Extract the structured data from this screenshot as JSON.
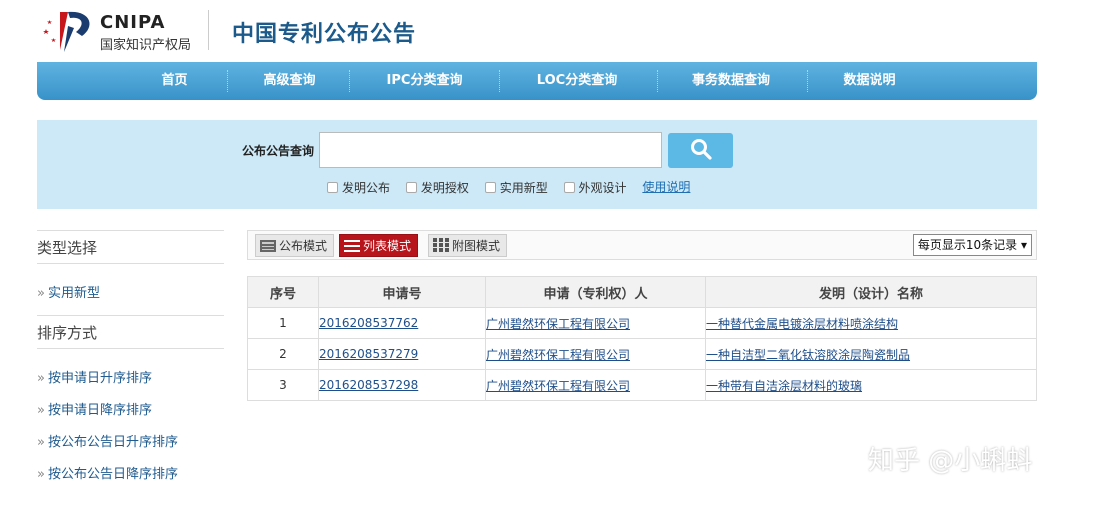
{
  "header": {
    "logo_en": "CNIPA",
    "logo_cn": "国家知识产权局",
    "site_title": "中国专利公布公告"
  },
  "nav": {
    "items": [
      "首页",
      "高级查询",
      "IPC分类查询",
      "LOC分类查询",
      "事务数据查询",
      "数据说明"
    ]
  },
  "search": {
    "label": "公布公告查询",
    "value": "",
    "placeholder": "",
    "options": [
      "发明公布",
      "发明授权",
      "实用新型",
      "外观设计"
    ],
    "help": "使用说明",
    "icon": "search-icon"
  },
  "sidebar": {
    "type_title": "类型选择",
    "type_items": [
      "实用新型"
    ],
    "sort_title": "排序方式",
    "sort_items": [
      "按申请日升序排序",
      "按申请日降序排序",
      "按公布公告日升序排序",
      "按公布公告日降序排序"
    ]
  },
  "toolbar": {
    "modes": [
      "公布模式",
      "列表模式",
      "附图模式"
    ],
    "active_mode": "列表模式",
    "per_page": "每页显示10条记录 ▾"
  },
  "table": {
    "headers": [
      "序号",
      "申请号",
      "申请（专利权）人",
      "发明（设计）名称"
    ],
    "rows": [
      [
        "1",
        "2016208537762",
        "广州碧然环保工程有限公司",
        "一种替代金属电镀涂层材料喷涂结构"
      ],
      [
        "2",
        "2016208537279",
        "广州碧然环保工程有限公司",
        "一种自洁型二氧化钛溶胶涂层陶瓷制品"
      ],
      [
        "3",
        "2016208537298",
        "广州碧然环保工程有限公司",
        "一种带有自洁涂层材料的玻璃"
      ]
    ]
  },
  "watermark": "知乎 @小蝌蚪",
  "colors": {
    "nav": "#3892c9",
    "title": "#1b5a8a",
    "active_mode": "#b8141b",
    "search_panel": "#cde8f6"
  }
}
